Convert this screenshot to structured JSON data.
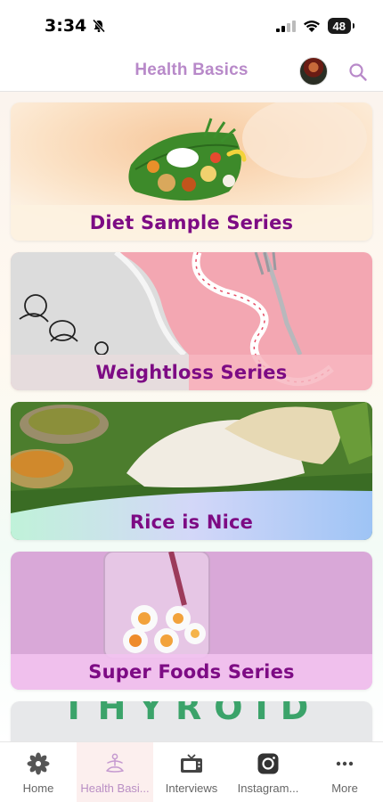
{
  "status_bar": {
    "time": "3:34",
    "battery": "48"
  },
  "header": {
    "title": "Health Basics"
  },
  "cards": [
    {
      "title": "Diet Sample Series"
    },
    {
      "title": "Weightloss Series"
    },
    {
      "title": "Rice is Nice"
    },
    {
      "title": "Super Foods Series"
    },
    {
      "title": "THYROID"
    }
  ],
  "tabs": [
    {
      "label": "Home",
      "icon": "flower-icon",
      "active": false
    },
    {
      "label": "Health Basi...",
      "icon": "yoga-icon",
      "active": true
    },
    {
      "label": "Interviews",
      "icon": "tv-icon",
      "active": false
    },
    {
      "label": "Instagram...",
      "icon": "instagram-icon",
      "active": false
    },
    {
      "label": "More",
      "icon": "more-dots-icon",
      "active": false
    }
  ],
  "colors": {
    "title_purple": "#7d0b84",
    "header_title": "#b889c9",
    "active_tab_bg": "#fcefee"
  }
}
